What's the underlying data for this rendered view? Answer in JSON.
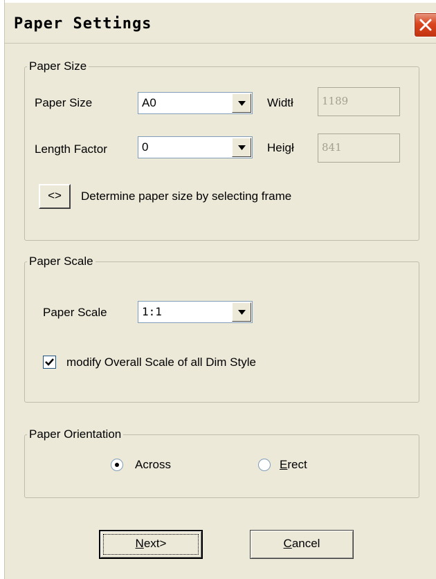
{
  "window": {
    "title": "Paper Settings"
  },
  "paper_size_group": {
    "legend": "Paper Size",
    "paper_size_label": "Paper Size",
    "paper_size_value": "A0",
    "width_label": "Widtł",
    "width_value": "1189",
    "length_factor_label": "Length Factor",
    "length_factor_value": "0",
    "height_label": "Heigł",
    "height_value": "841",
    "select_frame_button": "<>",
    "select_frame_text": "Determine paper size by selecting frame"
  },
  "paper_scale_group": {
    "legend": "Paper Scale",
    "paper_scale_label": "Paper Scale",
    "paper_scale_value": "1:1",
    "modify_scale_label": "modify Overall Scale of all Dim Style",
    "modify_scale_checked": true
  },
  "orientation_group": {
    "legend": "Paper Orientation",
    "options": [
      {
        "label": "Across",
        "selected": true
      },
      {
        "label": "Erect",
        "selected": false
      }
    ]
  },
  "buttons": {
    "next_label": "Next>",
    "cancel_label": "Cancel"
  },
  "colors": {
    "dialog_bg": "#ece9d8",
    "close_button": "#d9461f",
    "input_border": "#7f9db9"
  }
}
